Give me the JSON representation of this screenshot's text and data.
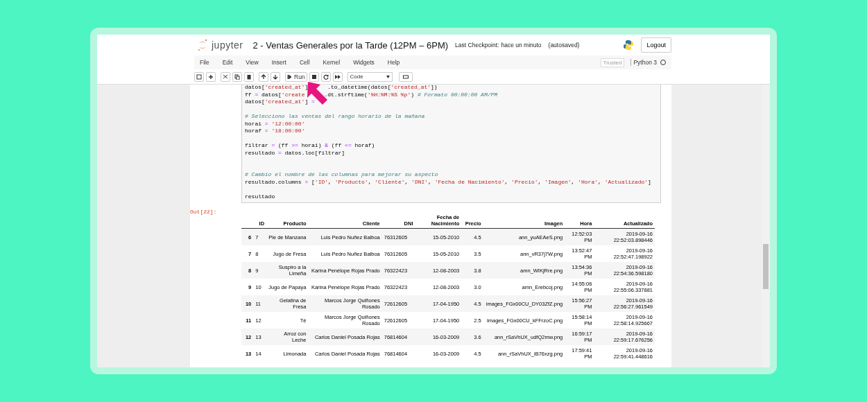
{
  "header": {
    "logo_text": "jupyter",
    "title": "2 - Ventas Generales por la Tarde (12PM – 6PM)",
    "checkpoint_label": "Last Checkpoint:",
    "checkpoint_time": "hace un minuto",
    "autosave": "(autosaved)",
    "logout": "Logout"
  },
  "menu": [
    "File",
    "Edit",
    "View",
    "Insert",
    "Cell",
    "Kernel",
    "Widgets",
    "Help"
  ],
  "trusted": "Trusted",
  "kernel": "Python 3",
  "kernel_busy": false,
  "toolbar": {
    "run": "Run",
    "cell_type": "Code"
  },
  "code": [
    {
      "kind": "code",
      "segments": [
        {
          "kind": "plain",
          "text": "datos["
        },
        {
          "kind": "str",
          "text": "'created_at'"
        },
        {
          "kind": "plain",
          "text": "]"
        },
        {
          "kind": "gap"
        },
        {
          "kind": "plain",
          "text": ".to_datetime(datos["
        },
        {
          "kind": "str",
          "text": "'created_at'"
        },
        {
          "kind": "plain",
          "text": "])"
        }
      ]
    },
    {
      "kind": "code",
      "segments": [
        {
          "kind": "plain",
          "text": "ff "
        },
        {
          "kind": "op",
          "text": "="
        },
        {
          "kind": "plain",
          "text": " datos["
        },
        {
          "kind": "str",
          "text": "'create"
        },
        {
          "kind": "gap"
        },
        {
          "kind": "plain",
          "text": ".dt.strftime("
        },
        {
          "kind": "str",
          "text": "'%H:%M:%S %p'"
        },
        {
          "kind": "plain",
          "text": ") "
        },
        {
          "kind": "comment",
          "text": "# Formato 00:00:00 AM/PM"
        }
      ]
    },
    {
      "kind": "code",
      "segments": [
        {
          "kind": "plain",
          "text": "datos["
        },
        {
          "kind": "str",
          "text": "'created_at'"
        },
        {
          "kind": "plain",
          "text": "] "
        },
        {
          "kind": "op",
          "text": "="
        }
      ]
    },
    {
      "kind": "blank"
    },
    {
      "kind": "code",
      "segments": [
        {
          "kind": "comment",
          "text": "# Selecciono las ventas del rango horario de la mañana"
        }
      ]
    },
    {
      "kind": "code",
      "segments": [
        {
          "kind": "plain",
          "text": "horai "
        },
        {
          "kind": "op",
          "text": "="
        },
        {
          "kind": "str",
          "text": " '12:00:00'"
        }
      ]
    },
    {
      "kind": "code",
      "segments": [
        {
          "kind": "plain",
          "text": "horaf "
        },
        {
          "kind": "op",
          "text": "="
        },
        {
          "kind": "str",
          "text": " '18:00:00'"
        }
      ]
    },
    {
      "kind": "blank"
    },
    {
      "kind": "code",
      "segments": [
        {
          "kind": "plain",
          "text": "filtrar "
        },
        {
          "kind": "op",
          "text": "="
        },
        {
          "kind": "plain",
          "text": " (ff "
        },
        {
          "kind": "op",
          "text": ">="
        },
        {
          "kind": "plain",
          "text": " horai) "
        },
        {
          "kind": "op",
          "text": "&"
        },
        {
          "kind": "plain",
          "text": " (ff "
        },
        {
          "kind": "op",
          "text": "<="
        },
        {
          "kind": "plain",
          "text": " horaf)"
        }
      ]
    },
    {
      "kind": "code",
      "segments": [
        {
          "kind": "plain",
          "text": "resultado "
        },
        {
          "kind": "op",
          "text": "="
        },
        {
          "kind": "plain",
          "text": " datos.loc[filtrar]"
        }
      ]
    },
    {
      "kind": "blank"
    },
    {
      "kind": "blank"
    },
    {
      "kind": "code",
      "segments": [
        {
          "kind": "comment",
          "text": "# Cambio el nombre de las columnas para mejorar su aspecto"
        }
      ]
    },
    {
      "kind": "code",
      "segments": [
        {
          "kind": "plain",
          "text": "resultado.columns "
        },
        {
          "kind": "op",
          "text": "="
        },
        {
          "kind": "plain",
          "text": " ["
        },
        {
          "kind": "str",
          "text": "'ID'"
        },
        {
          "kind": "plain",
          "text": ", "
        },
        {
          "kind": "str",
          "text": "'Producto'"
        },
        {
          "kind": "plain",
          "text": ", "
        },
        {
          "kind": "str",
          "text": "'Cliente'"
        },
        {
          "kind": "plain",
          "text": ", "
        },
        {
          "kind": "str",
          "text": "'DNI'"
        },
        {
          "kind": "plain",
          "text": ", "
        },
        {
          "kind": "str",
          "text": "'Fecha de Nacimiento'"
        },
        {
          "kind": "plain",
          "text": ", "
        },
        {
          "kind": "str",
          "text": "'Precio'"
        },
        {
          "kind": "plain",
          "text": ", "
        },
        {
          "kind": "str",
          "text": "'Imagen'"
        },
        {
          "kind": "plain",
          "text": ", "
        },
        {
          "kind": "str",
          "text": "'Hora'"
        },
        {
          "kind": "plain",
          "text": ", "
        },
        {
          "kind": "str",
          "text": "'Actualizado'"
        },
        {
          "kind": "plain",
          "text": "]"
        }
      ]
    },
    {
      "kind": "blank"
    },
    {
      "kind": "code",
      "segments": [
        {
          "kind": "plain",
          "text": "resultado"
        }
      ]
    }
  ],
  "out_prompt": "Out[22]:",
  "table": {
    "columns": [
      "ID",
      "Producto",
      "Cliente",
      "DNI",
      "Fecha de Nacimiento",
      "Precio",
      "Imagen",
      "Hora",
      "Actualizado"
    ],
    "rows": [
      {
        "index": "6",
        "cells": [
          "7",
          "Pie de Manzana",
          "Luis Pedro Nuñez Balboa",
          "76312605",
          "15-05-2010",
          "4.5",
          "ann_yuAEAeS.png",
          "12:52:03 PM",
          "2019-09-16 22:52:03.898446"
        ]
      },
      {
        "index": "7",
        "cells": [
          "8",
          "Jugo de Fresa",
          "Luis Pedro Nuñez Balboa",
          "76312605",
          "15-05-2010",
          "3.5",
          "ann_vR37j7W.png",
          "13:52:47 PM",
          "2019-09-16 22:52:47.198922"
        ]
      },
      {
        "index": "8",
        "cells": [
          "9",
          "Suspiro a la Limeña",
          "Karina Penélope Rojas Prado",
          "76322423",
          "12-08-2003",
          "3.8",
          "amn_WIKjRre.png",
          "13:54:36 PM",
          "2019-09-16 22:54:36.598180"
        ]
      },
      {
        "index": "9",
        "cells": [
          "10",
          "Jugo de Papaya",
          "Karina Penélope Rojas Prado",
          "76322423",
          "12-08-2003",
          "3.0",
          "amn_Erebcoj.png",
          "14:55:06 PM",
          "2019-09-16 22:55:06.337881"
        ]
      },
      {
        "index": "10",
        "cells": [
          "11",
          "Gelatina de Fresa",
          "Marcos Jorge Quiñones Rosado",
          "72612605",
          "17-04-1950",
          "4.5",
          "images_FGx00CU_DY03ZfZ.png",
          "15:56:27 PM",
          "2019-09-16 22:56:27.961549"
        ]
      },
      {
        "index": "11",
        "cells": [
          "12",
          "Té",
          "Marcos Jorge Quiñones Rosado",
          "72612605",
          "17-04-1950",
          "2.5",
          "images_FGx00CU_kFFrzoC.png",
          "15:58:14 PM",
          "2019-09-16 22:58:14.925667"
        ]
      },
      {
        "index": "12",
        "cells": [
          "13",
          "Arroz con Leche",
          "Carlos Daniel Posada Rojas",
          "76814604",
          "16-03-2009",
          "3.6",
          "ann_rSaVhUX_udfQ2mw.png",
          "16:59:17 PM",
          "2019-09-16 22:59:17.676256"
        ]
      },
      {
        "index": "13",
        "cells": [
          "14",
          "Limonada",
          "Carlos Daniel Posada Rojas",
          "76814604",
          "16-03-2009",
          "4.5",
          "ann_rSaVhUX_iB76xzg.png",
          "17:59:41 PM",
          "2019-09-16 22:59:41.448616"
        ]
      }
    ]
  }
}
